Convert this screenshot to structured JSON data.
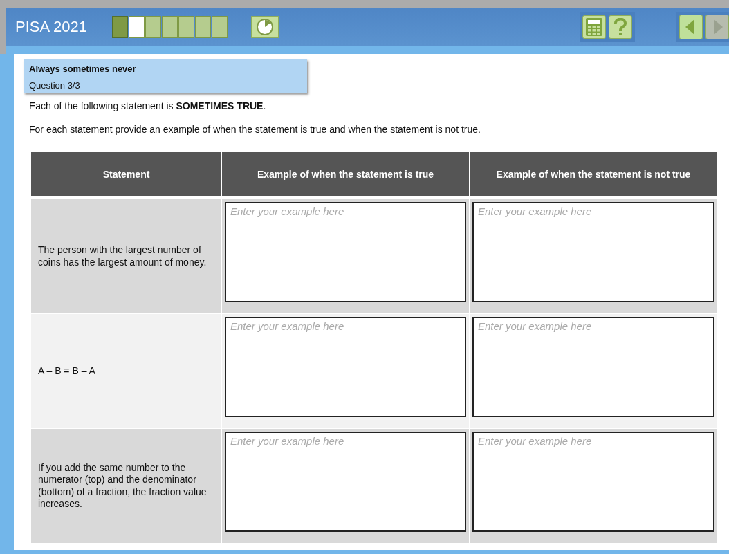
{
  "header": {
    "title": "PISA 2021",
    "progress": [
      {
        "done": true,
        "selected": false
      },
      {
        "done": false,
        "selected": true
      },
      {
        "done": false,
        "selected": false
      },
      {
        "done": false,
        "selected": false
      },
      {
        "done": false,
        "selected": false
      },
      {
        "done": false,
        "selected": false
      },
      {
        "done": false,
        "selected": false
      }
    ],
    "nav": [
      {
        "kind": "back",
        "disabled": false
      },
      {
        "kind": "next",
        "disabled": true
      }
    ]
  },
  "unit": {
    "title": "Always sometimes never",
    "question": "Question 3/3"
  },
  "instructions": [
    "Each of the following statement is **SOMETIMES TRUE**.",
    "For each statement provide an example of when the statement is true and when the statement is not true."
  ],
  "table": {
    "columns": [
      "Statement",
      "Example of when the statement is true",
      "Example of when the statement is not true"
    ],
    "rows": [
      {
        "statement": "The person with the largest number of coins has the largest amount of money.",
        "answers": [
          {
            "placeholder": "Enter your example here"
          },
          {
            "placeholder": "Enter your example here"
          }
        ]
      },
      {
        "statement": "A – B = B – A",
        "answers": [
          {
            "placeholder": "Enter your example here"
          },
          {
            "placeholder": "Enter your example here"
          }
        ]
      },
      {
        "statement": "If you add the same number to the numerator (top) and the denominator (bottom) of a fraction, the fraction value increases.",
        "answers": [
          {
            "placeholder": "Enter your example here"
          },
          {
            "placeholder": "Enter your example here"
          }
        ]
      }
    ]
  }
}
